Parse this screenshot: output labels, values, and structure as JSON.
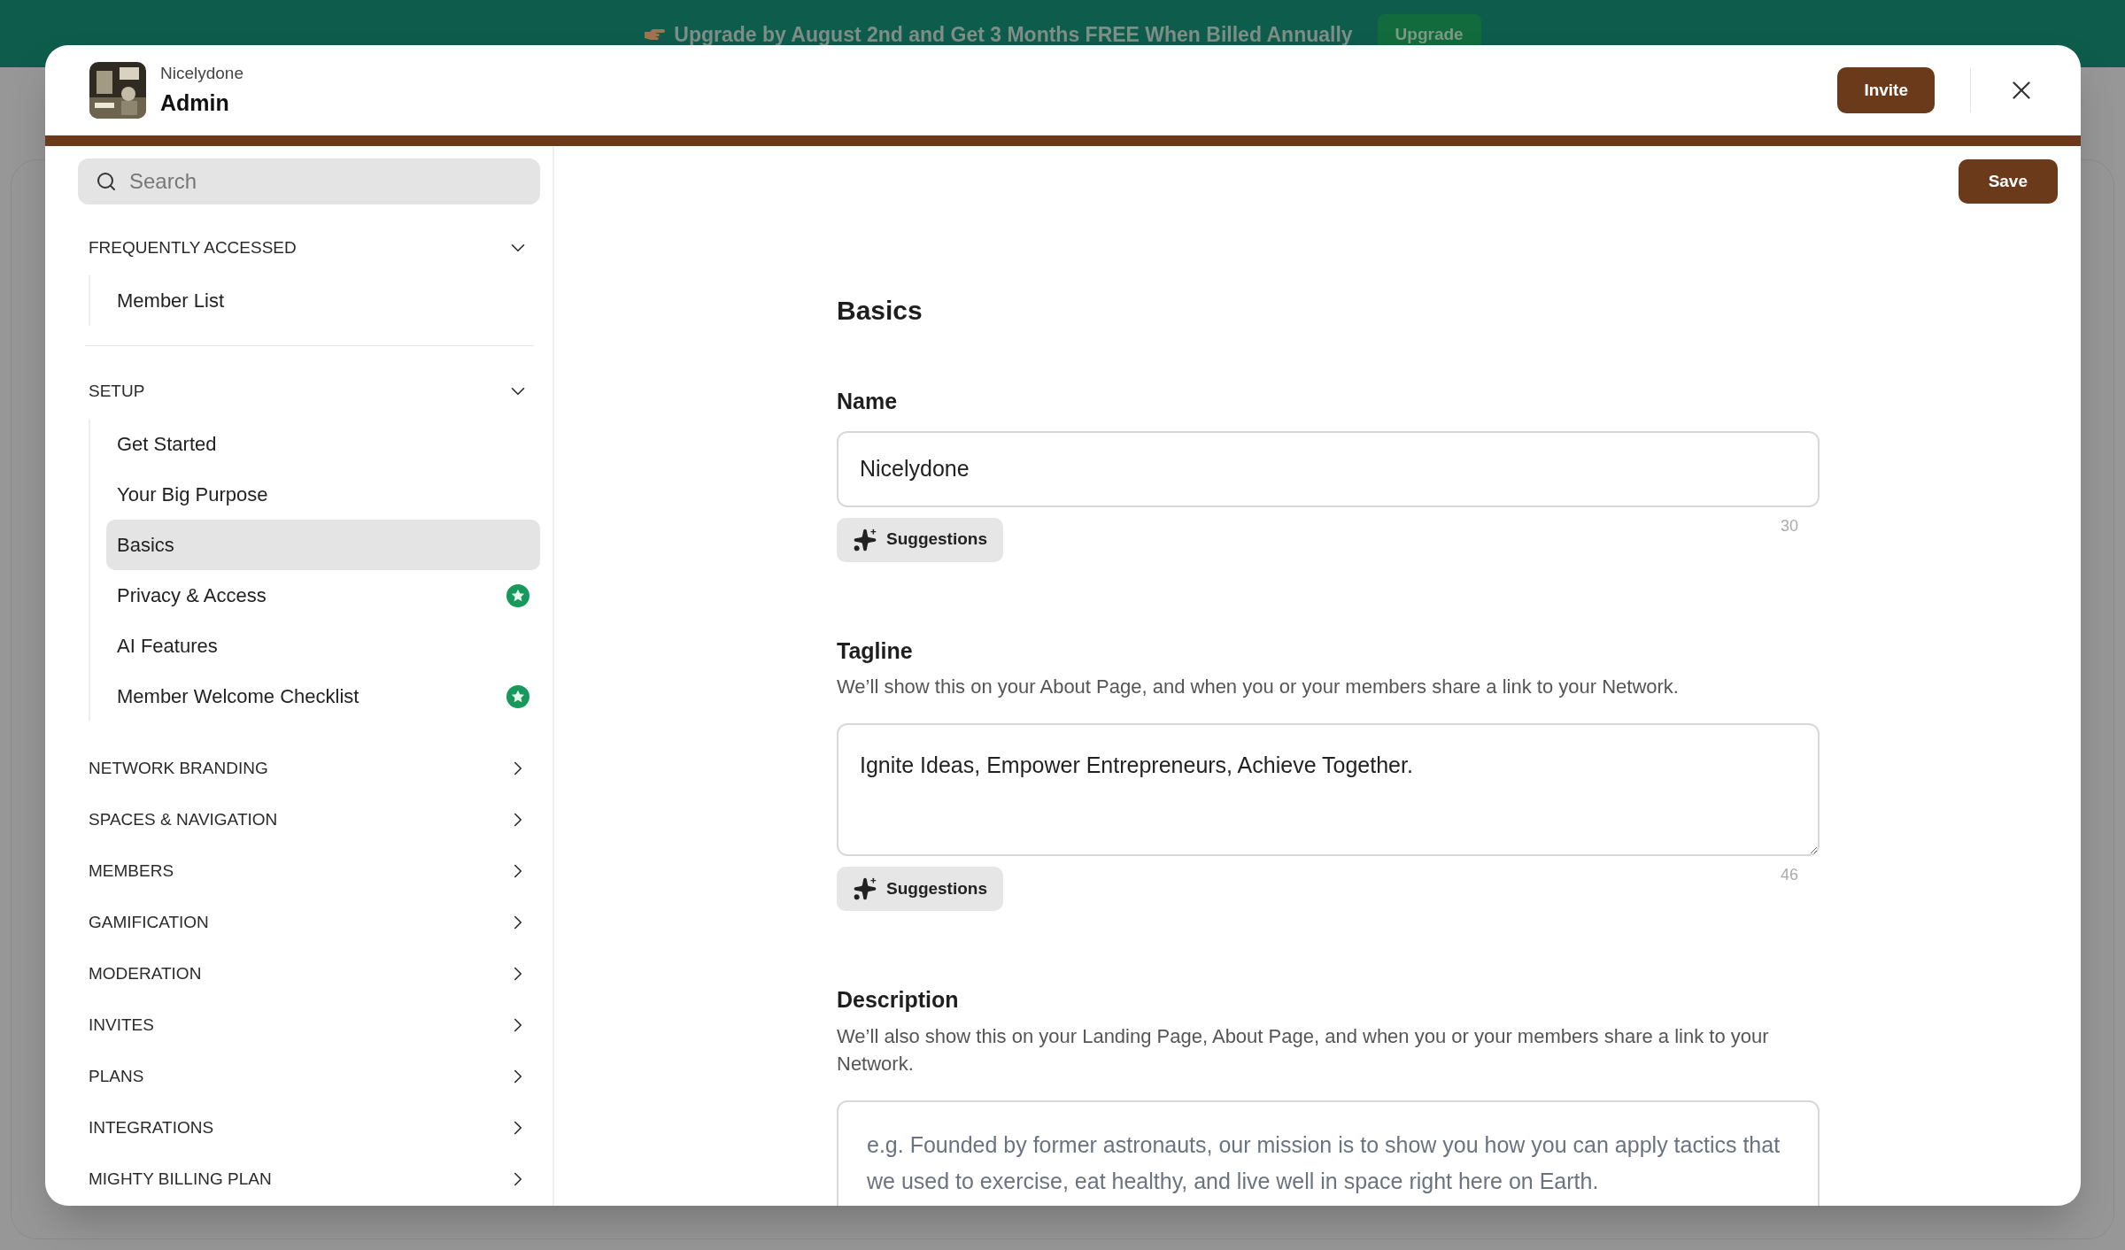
{
  "banner": {
    "text": "Upgrade by August 2nd and Get 3 Months FREE When Billed Annually",
    "button": "Upgrade"
  },
  "header": {
    "org": "Nicelydone",
    "title": "Admin",
    "invite": "Invite"
  },
  "sidebar": {
    "search": {
      "placeholder": "Search"
    },
    "sections": [
      {
        "title": "FREQUENTLY ACCESSED",
        "expanded": true,
        "items": [
          {
            "label": "Member List",
            "selected": false,
            "starred": false
          }
        ]
      },
      {
        "title": "SETUP",
        "expanded": true,
        "items": [
          {
            "label": "Get Started",
            "selected": false,
            "starred": false
          },
          {
            "label": "Your Big Purpose",
            "selected": false,
            "starred": false
          },
          {
            "label": "Basics",
            "selected": true,
            "starred": false
          },
          {
            "label": "Privacy & Access",
            "selected": false,
            "starred": true
          },
          {
            "label": "AI Features",
            "selected": false,
            "starred": false
          },
          {
            "label": "Member Welcome Checklist",
            "selected": false,
            "starred": true
          }
        ]
      },
      {
        "title": "NETWORK BRANDING",
        "expanded": false
      },
      {
        "title": "SPACES & NAVIGATION",
        "expanded": false
      },
      {
        "title": "MEMBERS",
        "expanded": false
      },
      {
        "title": "GAMIFICATION",
        "expanded": false
      },
      {
        "title": "MODERATION",
        "expanded": false
      },
      {
        "title": "INVITES",
        "expanded": false
      },
      {
        "title": "PLANS",
        "expanded": false
      },
      {
        "title": "INTEGRATIONS",
        "expanded": false
      },
      {
        "title": "MIGHTY BILLING PLAN",
        "expanded": false
      }
    ]
  },
  "save": "Save",
  "form": {
    "title": "Basics",
    "fields": [
      {
        "kind": "input",
        "label": "Name",
        "value": "Nicelydone",
        "suggestions": "Suggestions",
        "count": "30"
      },
      {
        "kind": "textarea",
        "label": "Tagline",
        "help": "We’ll show this on your About Page, and when you or your members share a link to your Network.",
        "value": "Ignite Ideas, Empower Entrepreneurs, Achieve Together.",
        "suggestions": "Suggestions",
        "count": "46"
      },
      {
        "kind": "textarea",
        "label": "Description",
        "help": "We’ll also show this on your Landing Page, About Page, and when you or your members share a link to your Network.",
        "placeholder": "e.g. Founded by former astronauts, our mission is to show you how you can apply tactics that we used to exercise, eat healthy, and live well in space right here on Earth."
      }
    ]
  }
}
